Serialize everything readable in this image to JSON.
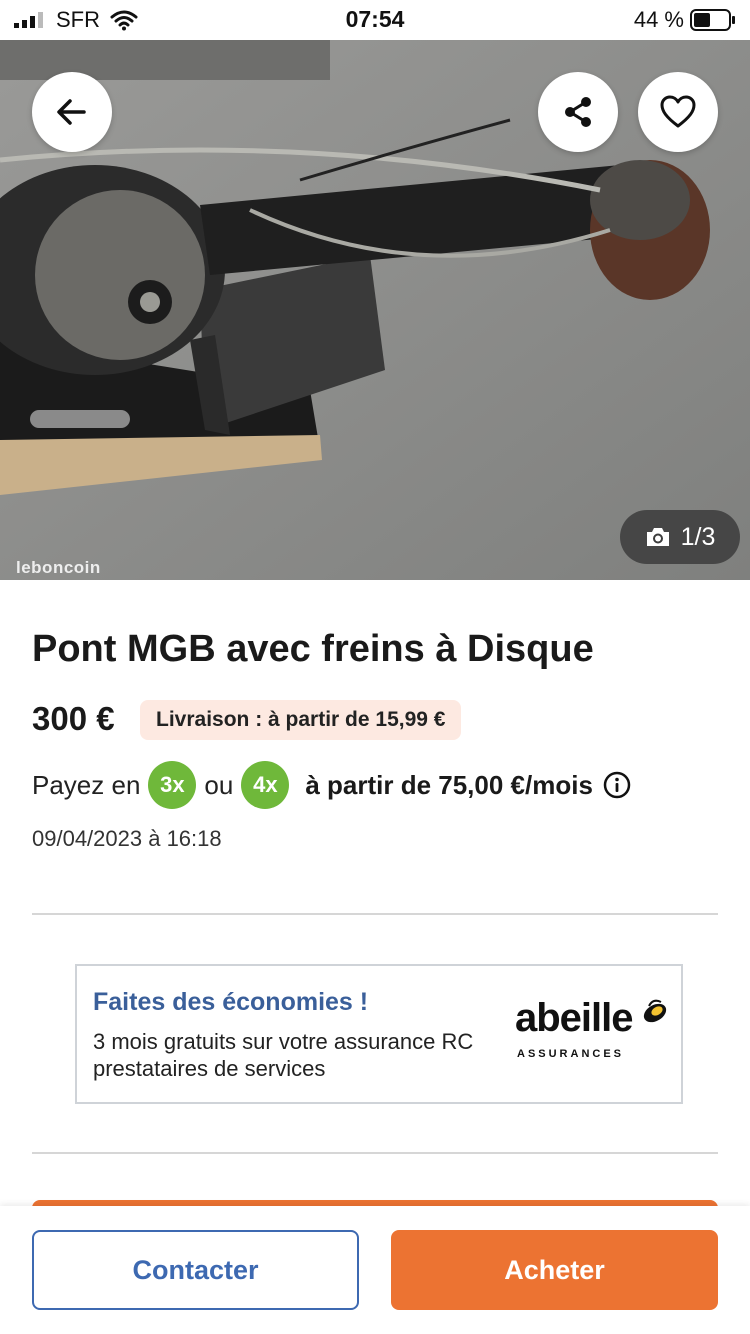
{
  "status_bar": {
    "carrier": "SFR",
    "time": "07:54",
    "battery": "44 %"
  },
  "hero": {
    "watermark": "leboncoin",
    "photo_counter": "1/3",
    "icons": [
      "back-arrow-icon",
      "share-icon",
      "heart-icon",
      "camera-icon"
    ]
  },
  "listing": {
    "title": "Pont MGB avec freins à Disque",
    "price": "300 €",
    "delivery": "Livraison : à partir de 15,99 €",
    "pay_prefix": "Payez en",
    "badge_3x": "3x",
    "pay_or": "ou",
    "badge_4x": "4x",
    "pay_suffix": "à partir de 75,00 €/mois",
    "date": "09/04/2023 à 16:18"
  },
  "ad": {
    "title": "Faites des économies !",
    "text": "3 mois gratuits sur votre assurance RC prestataires de services",
    "logo_word": "abeille",
    "logo_sub": "ASSURANCES"
  },
  "actions": {
    "contact_label": "Contacter",
    "buy_label": "Acheter"
  },
  "colors": {
    "brand_orange": "#ec7332",
    "contact_blue": "#3d69b1",
    "badge_green": "#6fb83a",
    "delivery_bg": "#fde9e1",
    "ad_title": "#3a5f9a"
  }
}
